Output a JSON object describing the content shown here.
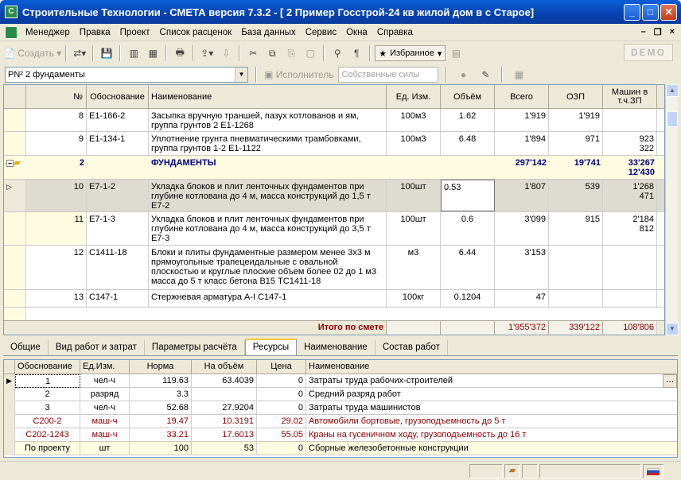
{
  "window": {
    "title": "Строительные Технологии - СМЕТА  версия 7.3.2 - [   2  Пример Госстрой-24 кв жилой дом в с Старое]"
  },
  "menu": [
    "Менеджер",
    "Правка",
    "Проект",
    "Список расценок",
    "База данных",
    "Сервис",
    "Окна",
    "Справка"
  ],
  "toolbar": {
    "create_label": "Создать",
    "favorites_label": "Избранное",
    "demo_label": "DEMO"
  },
  "toolbar2": {
    "section_select_value": "РN² 2 фундаменты",
    "executor_label": "Исполнитель",
    "executor_value": "Собственные силы"
  },
  "grid": {
    "columns": [
      "№",
      "Обоснование",
      "Наименование",
      "Ед. Изм.",
      "Объём",
      "Всего",
      "ОЗП",
      "Машин в т.ч.ЗП"
    ],
    "rows": [
      {
        "num": "8",
        "code": "Е1-166-2",
        "name": "Засыпка вручную траншей, пазух котлованов и ям, группа грунтов 2 Е1-1268",
        "unit": "100м3",
        "qty": "1.62",
        "total": "1'919",
        "ozp": "1'919",
        "mach": ""
      },
      {
        "num": "9",
        "code": "Е1-134-1",
        "name": "Уплотнение грунта пневматическими трамбовками, группа грунтов 1-2 Е1-1122",
        "unit": "100м3",
        "qty": "6.48",
        "total": "1'894",
        "ozp": "971",
        "mach": "923\n322"
      },
      {
        "num": "2",
        "code": "",
        "name": "ФУНДАМЕНТЫ",
        "unit": "",
        "qty": "",
        "total": "297'142",
        "ozp": "19'741",
        "mach": "33'267\n12'430"
      },
      {
        "num": "10",
        "code": "Е7-1-2",
        "name": "Укладка блоков и плит ленточных фундаментов при глубине котлована до 4 м, масса конструкций до 1,5 т Е7-2",
        "unit": "100шт",
        "qty": "0.53",
        "total": "1'807",
        "ozp": "539",
        "mach": "1'268\n471"
      },
      {
        "num": "11",
        "code": "Е7-1-3",
        "name": "Укладка блоков и плит ленточных фундаментов при глубине котлована до 4 м, масса конструкций до 3,5 т Е7-3",
        "unit": "100шт",
        "qty": "0.6",
        "total": "3'099",
        "ozp": "915",
        "mach": "2'184\n812"
      },
      {
        "num": "12",
        "code": "С1411-18",
        "name": "Блоки и плиты фундаментные размером менее 3х3 м прямоугольные трапецеидальные с овальной плоскостью и круглые плоские объем более 02 до 1 м3 масса до 5 т класс бетона В15 ТС1411-18",
        "unit": "м3",
        "qty": "6.44",
        "total": "3'153",
        "ozp": "",
        "mach": ""
      },
      {
        "num": "13",
        "code": "С147-1",
        "name": "Стержневая арматура А-I С147-1",
        "unit": "100кг",
        "qty": "0.1204",
        "total": "47",
        "ozp": "",
        "mach": ""
      }
    ],
    "total_label": "Итого по смете",
    "total_all": "1'955'372",
    "total_ozp": "339'122",
    "total_mach": "108'806"
  },
  "tabs": [
    "Общие",
    "Вид работ и затрат",
    "Параметры расчёта",
    "Ресурсы",
    "Наименование",
    "Состав работ"
  ],
  "resources": {
    "columns": [
      "Обоснование",
      "Ед.Изм.",
      "Норма",
      "На объём",
      "Цена",
      "Наименование"
    ],
    "rows": [
      {
        "code": "1",
        "unit": "чел-ч",
        "norm": "119.63",
        "vol": "63.4039",
        "price": "0",
        "name": "Затраты труда рабочих-строителей"
      },
      {
        "code": "2",
        "unit": "разряд",
        "norm": "3.3",
        "vol": "",
        "price": "0",
        "name": "Средний разряд работ"
      },
      {
        "code": "3",
        "unit": "чел-ч",
        "norm": "52.68",
        "vol": "27.9204",
        "price": "0",
        "name": "Затраты труда машинистов"
      },
      {
        "code": "С200-2",
        "unit": "маш-ч",
        "norm": "19.47",
        "vol": "10.3191",
        "price": "29.02",
        "name": "Автомобили бортовые, грузоподъемность до 5 т"
      },
      {
        "code": "С202-1243",
        "unit": "маш-ч",
        "norm": "33.21",
        "vol": "17.6013",
        "price": "55.05",
        "name": "Краны на гусеничном ходу, грузоподъемность до 16 т"
      },
      {
        "code": "По проекту",
        "unit": "шт",
        "norm": "100",
        "vol": "53",
        "price": "0",
        "name": "Сборные железобетонные конструкции"
      }
    ]
  },
  "colors": {
    "accent": "#0a5fd8",
    "resource_red": "#8b0000",
    "section_blue": "#000080"
  }
}
